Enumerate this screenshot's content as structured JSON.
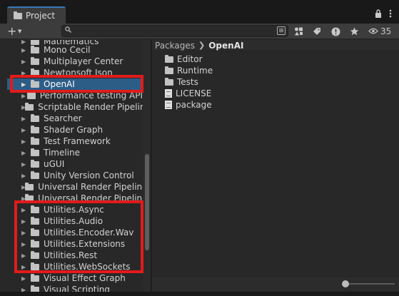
{
  "window": {
    "tab_label": "Project",
    "icons": [
      "lock-icon",
      "kebab-menu-icon"
    ]
  },
  "toolbar": {
    "add_label": "+",
    "search_value": "",
    "hidden_count": "35",
    "icons": [
      "search-by-type-icon",
      "search-by-label-icon",
      "important-icon",
      "favorite-star-icon",
      "eye-icon"
    ]
  },
  "tree": {
    "items": [
      {
        "label": "Mathematics"
      },
      {
        "label": "Mono Cecil"
      },
      {
        "label": "Multiplayer Center"
      },
      {
        "label": "Newtonsoft Json"
      },
      {
        "label": "OpenAI"
      },
      {
        "label": "Performance testing API"
      },
      {
        "label": "Scriptable Render Pipelin"
      },
      {
        "label": "Searcher"
      },
      {
        "label": "Shader Graph"
      },
      {
        "label": "Test Framework"
      },
      {
        "label": "Timeline"
      },
      {
        "label": "uGUI"
      },
      {
        "label": "Unity Version Control"
      },
      {
        "label": "Universal Render Pipeline"
      },
      {
        "label": "Universal Render Pipeline"
      },
      {
        "label": "Utilities.Async"
      },
      {
        "label": "Utilities.Audio"
      },
      {
        "label": "Utilities.Encoder.Wav"
      },
      {
        "label": "Utilities.Extensions"
      },
      {
        "label": "Utilities.Rest"
      },
      {
        "label": "Utilities.WebSockets"
      },
      {
        "label": "Visual Effect Graph"
      },
      {
        "label": "Visual Scripting"
      }
    ],
    "selected_label": "OpenAI"
  },
  "content": {
    "breadcrumb": [
      "Packages",
      "OpenAI"
    ],
    "files": [
      {
        "label": "Editor",
        "icon": "folder-icon"
      },
      {
        "label": "Runtime",
        "icon": "folder-icon"
      },
      {
        "label": "Tests",
        "icon": "folder-icon"
      },
      {
        "label": "LICENSE",
        "icon": "document-icon"
      },
      {
        "label": "package",
        "icon": "document-icon"
      }
    ]
  },
  "colors": {
    "highlight": "#e21b1b",
    "selection": "#2c5d87",
    "tab_accent": "#3a79bb"
  }
}
